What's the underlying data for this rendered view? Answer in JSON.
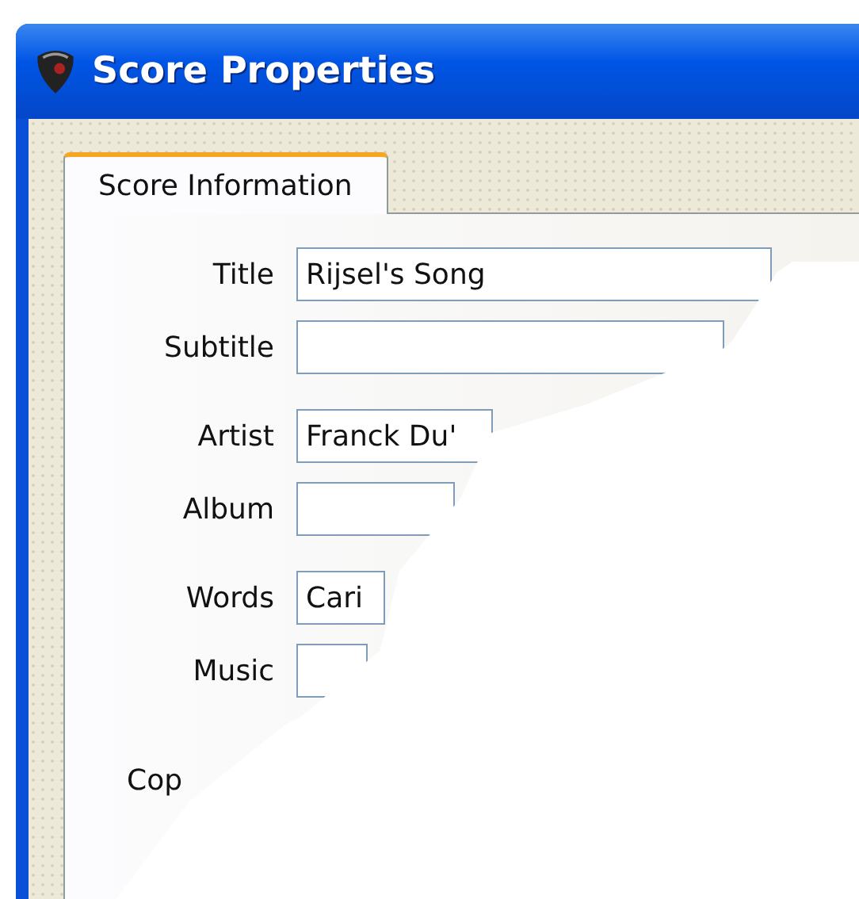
{
  "window": {
    "title": "Score Properties"
  },
  "tabs": [
    {
      "label": "Score Information",
      "selected": true
    }
  ],
  "field_groups": [
    [
      {
        "kind": "text_field",
        "label": "Title",
        "value": "Rijsel's Song"
      },
      {
        "kind": "text_field",
        "label": "Subtitle"
      }
    ],
    [
      {
        "kind": "text_field",
        "label": "Artist",
        "value": "Franck Du'"
      },
      {
        "kind": "text_field",
        "label": "Album"
      }
    ],
    [
      {
        "kind": "text_field",
        "label": "Words",
        "value": "Cari"
      },
      {
        "kind": "text_field",
        "label": "Music"
      }
    ],
    [
      {
        "kind": "label",
        "label": "Cop"
      }
    ]
  ]
}
